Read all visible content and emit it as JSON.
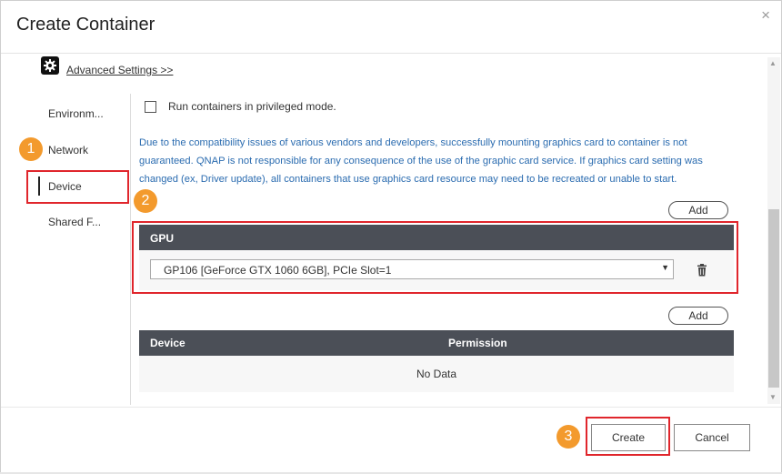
{
  "dialog": {
    "title": "Create Container",
    "close_glyph": "×"
  },
  "advanced_settings": {
    "link": "Advanced Settings >>",
    "icon": "gear-icon"
  },
  "sidebar": {
    "items": [
      {
        "label": "Environm..."
      },
      {
        "label": "Network"
      },
      {
        "label": "Device",
        "active": true
      },
      {
        "label": "Shared F..."
      }
    ]
  },
  "callouts": [
    "1",
    "2",
    "3"
  ],
  "privileged": {
    "label": "Run containers in privileged mode.",
    "checked": false
  },
  "notice": "Due to the compatibility issues of various vendors and developers, successfully mounting graphics card to container is not guaranteed. QNAP is not responsible for any consequence of the use of the graphic card service. If graphics card setting was changed (ex, Driver update), all containers that use graphics card resource may need to be recreated or unable to start.",
  "gpu_section": {
    "add_label": "Add",
    "header": "GPU",
    "selected": "GP106 [GeForce GTX 1060 6GB], PCIe Slot=1",
    "delete_icon": "trash-icon"
  },
  "device_section": {
    "add_label": "Add",
    "columns": [
      "Device",
      "Permission"
    ],
    "empty_text": "No Data"
  },
  "footer": {
    "create_label": "Create",
    "cancel_label": "Cancel"
  },
  "colors": {
    "accent_callout": "#f39a2d",
    "highlight": "#e0262c",
    "header_bg": "#4b4f57",
    "notice_text": "#2b6cb0"
  }
}
